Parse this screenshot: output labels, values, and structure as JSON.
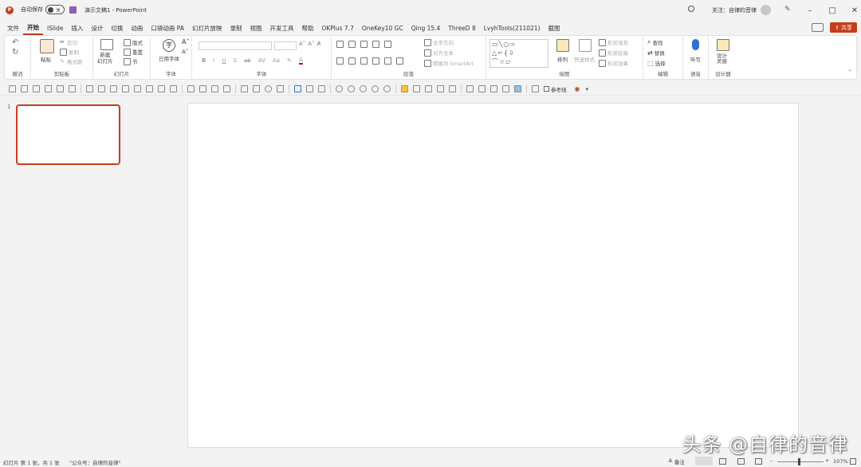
{
  "titlebar": {
    "autosave_label": "自动保存",
    "autosave_toggle": "关",
    "doc_title": "演示文稿1  -  PowerPoint",
    "user_label": "关注：自律的音律",
    "minimize": "–",
    "maximize": "□",
    "close": "✕"
  },
  "menu": {
    "tabs": [
      "文件",
      "开始",
      "iSlide",
      "插入",
      "设计",
      "切换",
      "动画",
      "口袋动画 PA",
      "幻灯片放映",
      "录制",
      "视图",
      "开发工具",
      "帮助",
      "OKPlus 7.7",
      "OneKey10 GC",
      "Qing 15.4",
      "ThreeD 8",
      "LvyhTools(211021)",
      "截图"
    ],
    "active_tab": "开始",
    "share_label": "共享"
  },
  "ribbon": {
    "undo": {
      "label": "撤消"
    },
    "clipboard": {
      "paste": "粘贴",
      "cut": "剪切",
      "copy": "复制",
      "format_painter": "格式刷",
      "label": "剪贴板"
    },
    "slides": {
      "new_slide": "新建\n幻灯片",
      "layout": "版式",
      "reset": "重置",
      "section": "节",
      "label": "幻灯片"
    },
    "font_group": {
      "used_font": "已用字体",
      "label": "字体"
    },
    "font": {
      "label": "字体"
    },
    "paragraph": {
      "text_direction": "文字方向",
      "align_text": "对齐文本",
      "smartart": "转换为 SmartArt",
      "label": "段落"
    },
    "drawing": {
      "arrange": "排列",
      "quick_styles": "快速样式",
      "shape_fill": "形状填充",
      "shape_outline": "形状轮廓",
      "shape_effects": "形状效果",
      "label": "绘图"
    },
    "editing": {
      "find": "查找",
      "replace": "替换",
      "select": "选择",
      "label": "编辑"
    },
    "voice": {
      "dictate": "听写",
      "label": "语音"
    },
    "designer": {
      "design_ideas": "设计\n灵感",
      "label": "设计器"
    }
  },
  "quickbar": {
    "guides_label": "参考线"
  },
  "slides_panel": {
    "slide_number": "1"
  },
  "statusbar": {
    "slide_info": "幻灯片 第 1 张，共 1 张",
    "extra": "\"公众号：自律的音律\"",
    "notes": "备注",
    "zoom_level": "107%",
    "zoom_minus": "–",
    "zoom_plus": "+"
  },
  "watermark": {
    "text": "头条 @自律的音律"
  },
  "colors": {
    "accent": "#c43e1c",
    "share": "#c43e1c"
  }
}
